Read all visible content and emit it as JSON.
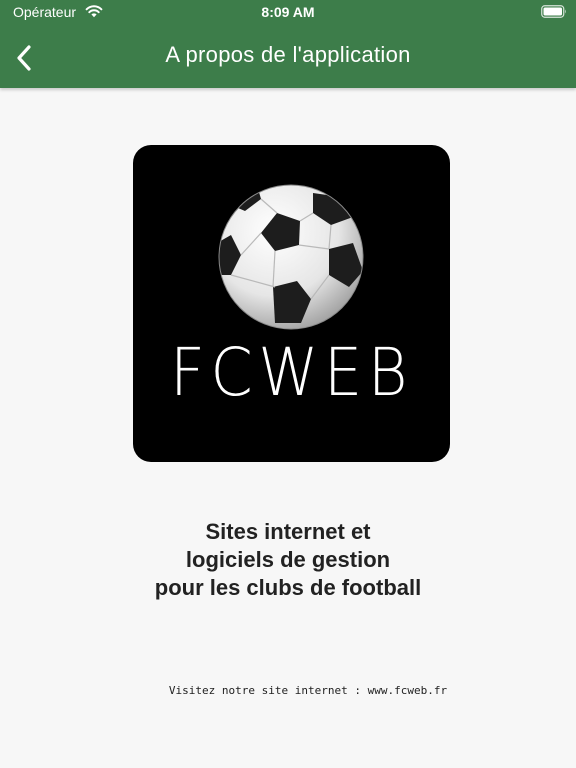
{
  "status_bar": {
    "carrier": "Opérateur",
    "time": "8:09 AM"
  },
  "nav": {
    "title": "A propos de l'application",
    "back_icon": "chevron-left-icon"
  },
  "logo": {
    "wordmark": "FCWEB",
    "icon": "soccer-ball-icon"
  },
  "tagline": {
    "lines": [
      "Sites internet et",
      "logiciels de gestion",
      "pour les clubs de football"
    ]
  },
  "footer": {
    "text": "Visitez notre site internet : www.fcweb.fr"
  },
  "colors": {
    "header": "#3d7d4a",
    "background": "#f7f7f7",
    "logo_background": "#000000",
    "text": "#222222"
  }
}
